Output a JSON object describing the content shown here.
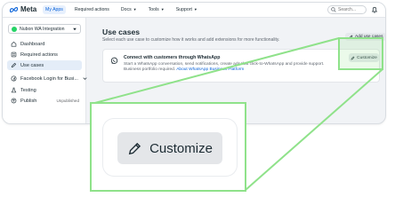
{
  "header": {
    "logo_text": "Meta",
    "nav": [
      {
        "label": "My Apps",
        "active": true
      },
      {
        "label": "Required actions",
        "active": false
      },
      {
        "label": "Docs",
        "active": false
      },
      {
        "label": "Tools",
        "active": false
      },
      {
        "label": "Support",
        "active": false
      }
    ],
    "search_placeholder": "Search..."
  },
  "sidebar": {
    "app_name": "Nubon WA Integration",
    "items": [
      {
        "label": "Dashboard",
        "icon": "home-icon"
      },
      {
        "label": "Required actions",
        "icon": "list-icon"
      },
      {
        "label": "Use cases",
        "icon": "pencil-icon",
        "active": true
      },
      {
        "label": "Facebook Login for Busi...",
        "icon": "facebook-icon"
      },
      {
        "label": "Testing",
        "icon": "flask-icon"
      },
      {
        "label": "Publish",
        "icon": "publish-icon",
        "badge": "Unpublished"
      }
    ]
  },
  "main": {
    "title": "Use cases",
    "subtitle": "Select each use case to customize how it works and add extensions for more functionality.",
    "add_button": "Add use cases",
    "card": {
      "title": "Connect with customers through WhatsApp",
      "description": "Start a WhatsApp conversation, send notifications, create ads that click-to-WhatsApp and provide support. Business portfolio required.",
      "link": "About WhatsApp Business Platform",
      "button": "Customize"
    }
  },
  "zoom": {
    "button_label": "Customize"
  },
  "colors": {
    "accent": "#0a63d9",
    "highlight": "#8fe28a",
    "whatsapp": "#25d366"
  }
}
